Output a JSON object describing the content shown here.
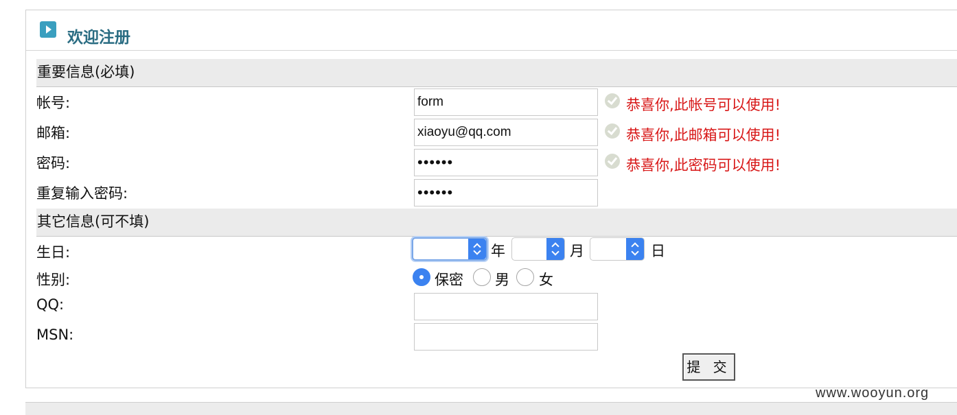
{
  "header": {
    "title": "欢迎注册",
    "icon": "play-icon"
  },
  "sections": {
    "required": "重要信息(必填)",
    "optional": "其它信息(可不填)"
  },
  "fields": {
    "account": {
      "label": "帐号:",
      "value": "form",
      "status": "恭喜你,此帐号可以使用!"
    },
    "email": {
      "label": "邮箱:",
      "value": "xiaoyu@qq.com",
      "status": "恭喜你,此邮箱可以使用!"
    },
    "password": {
      "label": "密码:",
      "value": "••••••",
      "status": "恭喜你,此密码可以使用!"
    },
    "confirm_password": {
      "label": "重复输入密码:",
      "value": "••••••"
    },
    "birthday": {
      "label": "生日:",
      "year_unit": "年",
      "month_unit": "月",
      "day_unit": "日"
    },
    "gender": {
      "label": "性别:",
      "options": [
        "保密",
        "男",
        "女"
      ],
      "selected": "保密"
    },
    "qq": {
      "label": "QQ:",
      "value": ""
    },
    "msn": {
      "label": "MSN:",
      "value": ""
    }
  },
  "submit_label": "提 交",
  "watermark": "www.wooyun.org",
  "colors": {
    "header_title": "#2b6d83",
    "status_ok": "#d81717",
    "accent": "#3b82f0"
  }
}
